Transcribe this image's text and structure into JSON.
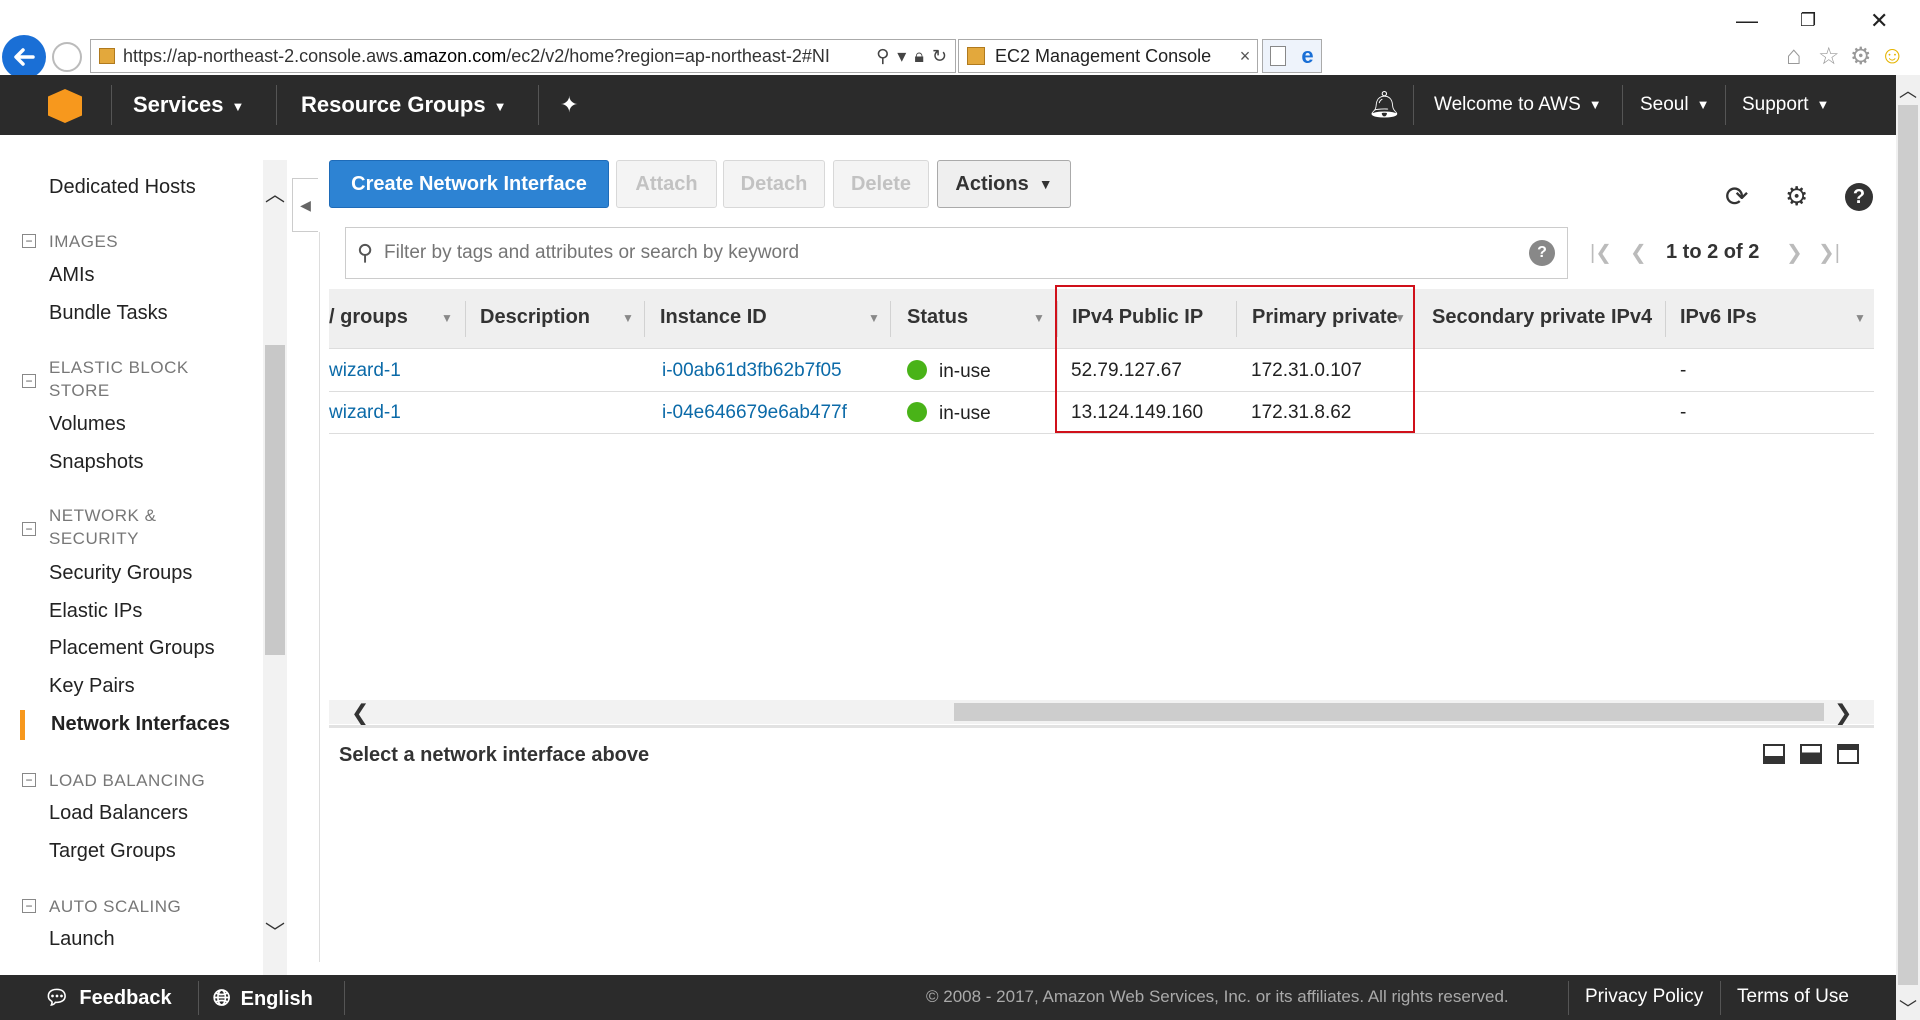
{
  "browser": {
    "url_prefix": "https://ap-northeast-2.console.aws.",
    "url_domain": "amazon.com",
    "url_suffix": "/ec2/v2/home?region=ap-northeast-2#NI",
    "tab_title": "EC2 Management Console",
    "tab_close": "×"
  },
  "topnav": {
    "services": "Services",
    "resource_groups": "Resource Groups",
    "welcome": "Welcome to AWS",
    "region": "Seoul",
    "support": "Support"
  },
  "sidebar": {
    "dedicated_hosts": "Dedicated Hosts",
    "images_head": "IMAGES",
    "amis": "AMIs",
    "bundle_tasks": "Bundle Tasks",
    "ebs_head_1": "ELASTIC BLOCK",
    "ebs_head_2": "STORE",
    "volumes": "Volumes",
    "snapshots": "Snapshots",
    "netsec_head_1": "NETWORK &",
    "netsec_head_2": "SECURITY",
    "security_groups": "Security Groups",
    "elastic_ips": "Elastic IPs",
    "placement_groups": "Placement Groups",
    "key_pairs": "Key Pairs",
    "network_interfaces": "Network Interfaces",
    "lb_head": "LOAD BALANCING",
    "load_balancers": "Load Balancers",
    "target_groups": "Target Groups",
    "as_head": "AUTO SCALING",
    "launch": "Launch"
  },
  "toolbar": {
    "create": "Create Network Interface",
    "attach": "Attach",
    "detach": "Detach",
    "delete": "Delete",
    "actions": "Actions"
  },
  "filter": {
    "placeholder": "Filter by tags and attributes or search by keyword",
    "help": "?"
  },
  "pager": {
    "text": "1 to 2 of 2"
  },
  "table": {
    "headers": {
      "groups": "/ groups",
      "description": "Description",
      "instance_id": "Instance ID",
      "status": "Status",
      "ipv4_public": "IPv4 Public IP",
      "primary_private": "Primary private",
      "secondary_private": "Secondary private IPv4",
      "ipv6": "IPv6 IPs"
    },
    "rows": [
      {
        "group": "wizard-1",
        "instance_id": "i-00ab61d3fb62b7f05",
        "status": "in-use",
        "ipv4_public": "52.79.127.67",
        "primary_private": "172.31.0.107",
        "ipv6": "-"
      },
      {
        "group": "wizard-1",
        "instance_id": "i-04e646679e6ab477f",
        "status": "in-use",
        "ipv4_public": "13.124.149.160",
        "primary_private": "172.31.8.62",
        "ipv6": "-"
      }
    ]
  },
  "detail": {
    "title": "Select a network interface above"
  },
  "footer": {
    "feedback": "Feedback",
    "english": "English",
    "copyright": "© 2008 - 2017, Amazon Web Services, Inc. or its affiliates. All rights reserved.",
    "privacy": "Privacy Policy",
    "terms": "Terms of Use"
  },
  "colors": {
    "accent_orange": "#f7981d",
    "primary_blue": "#2d83d3",
    "highlight_red": "#d0101a",
    "status_green": "#49b318",
    "link_blue": "#0b6aa8"
  }
}
